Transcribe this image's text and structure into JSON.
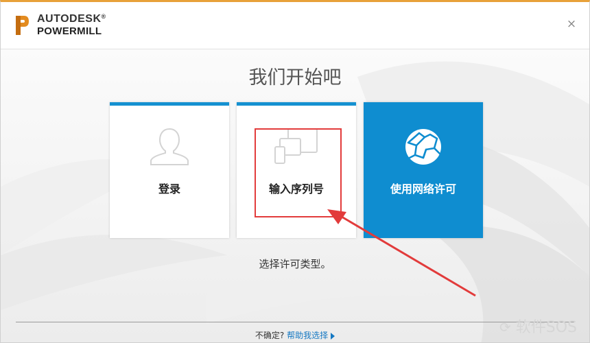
{
  "header": {
    "brand_line1": "AUTODESK",
    "brand_reg": "®",
    "brand_line2": "POWERMILL",
    "close_label": "×",
    "accent": "#e8a13a"
  },
  "main": {
    "title": "我们开始吧",
    "cards": [
      {
        "label": "登录",
        "icon": "user-icon"
      },
      {
        "label": "输入序列号",
        "icon": "devices-icon"
      },
      {
        "label": "使用网络许可",
        "icon": "network-globe-icon",
        "selected": true
      }
    ],
    "hint": "选择许可类型。",
    "card_accent": "#1591d1"
  },
  "footer": {
    "question": "不确定?",
    "help_link": "帮助我选择"
  },
  "watermark": {
    "text": "软件SOS"
  },
  "annotation": {
    "highlight_color": "#e23b3b"
  }
}
